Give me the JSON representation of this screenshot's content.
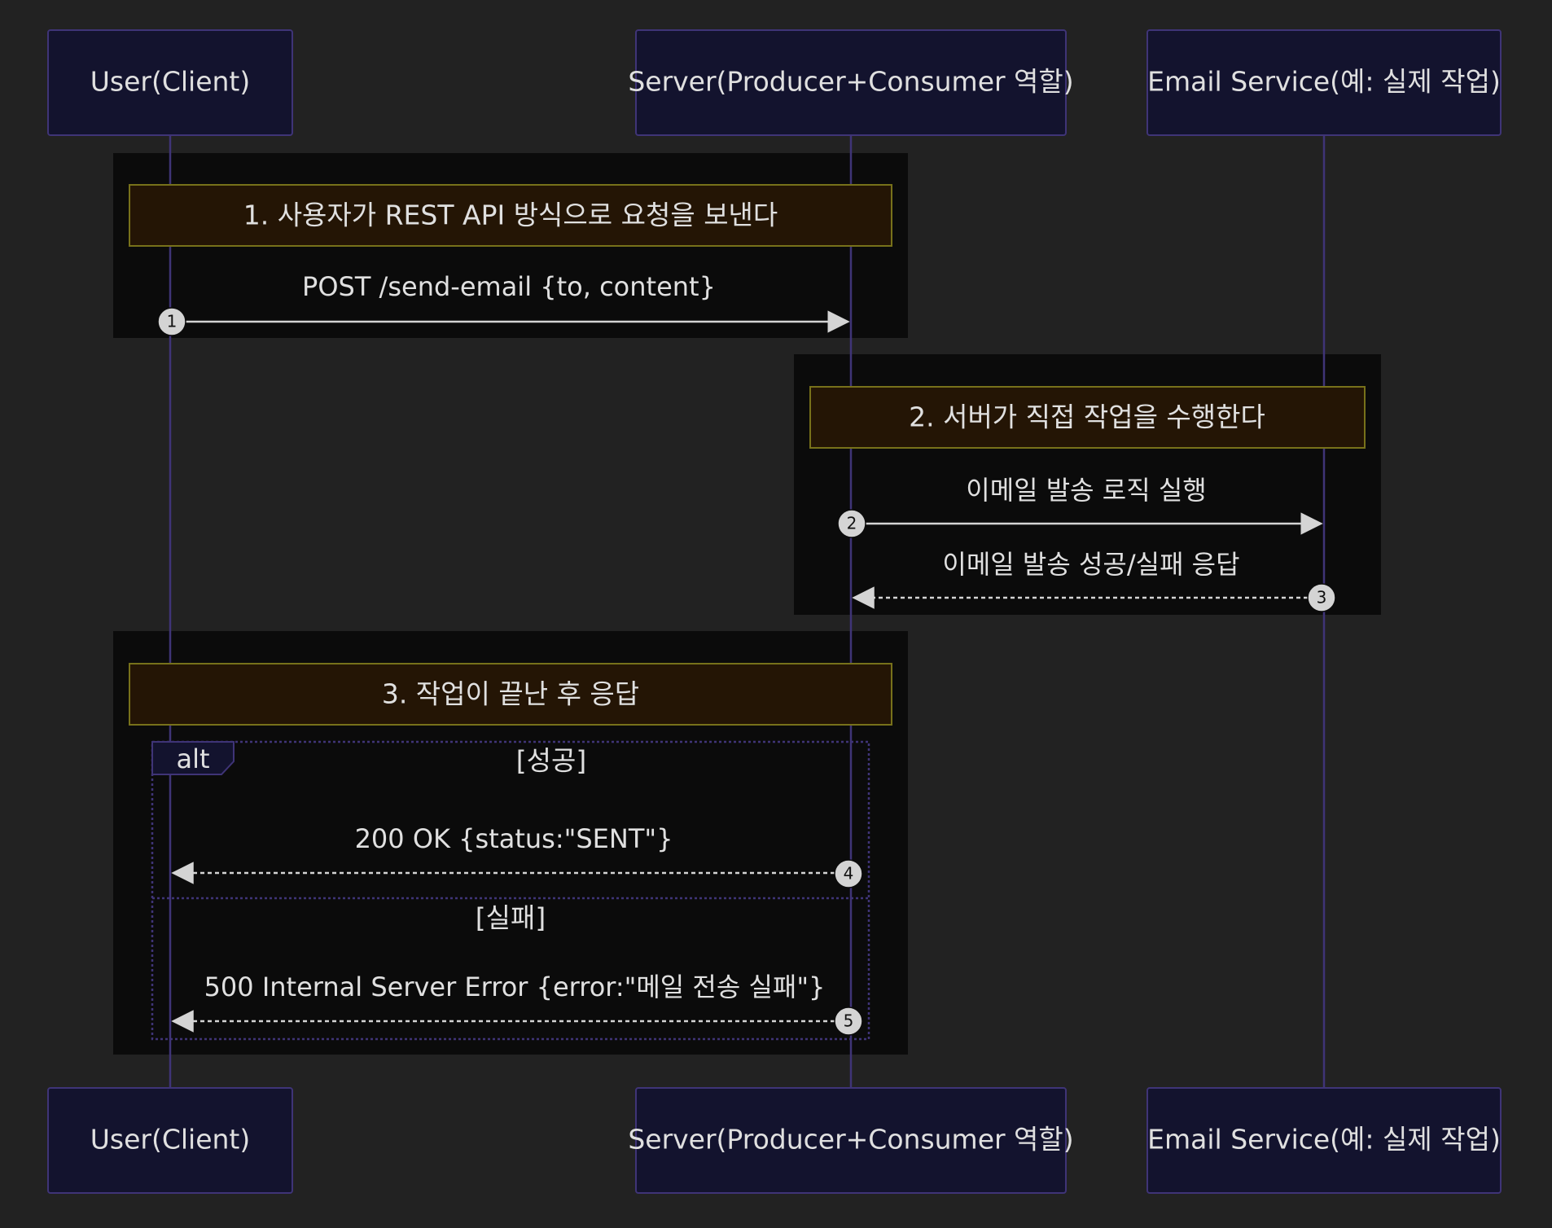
{
  "participants": [
    {
      "id": "user",
      "label": "User(Client)"
    },
    {
      "id": "server",
      "label": "Server(Producer+Consumer 역할)"
    },
    {
      "id": "email",
      "label": "Email Service(예: 실제 작업)"
    }
  ],
  "notes": {
    "step1": "1. 사용자가 REST API 방식으로 요청을 보낸다",
    "step2": "2. 서버가 직접 작업을 수행한다",
    "step3": "3. 작업이 끝난 후 응답"
  },
  "messages": [
    {
      "num": "1",
      "text": "POST /send-email {to, content}",
      "from": "user",
      "to": "server",
      "style": "solid"
    },
    {
      "num": "2",
      "text": "이메일 발송 로직 실행",
      "from": "server",
      "to": "email",
      "style": "solid"
    },
    {
      "num": "3",
      "text": "이메일 발송 성공/실패 응답",
      "from": "email",
      "to": "server",
      "style": "dashed"
    },
    {
      "num": "4",
      "text": "200 OK {status:\"SENT\"}",
      "from": "server",
      "to": "user",
      "style": "dashed"
    },
    {
      "num": "5",
      "text": "500 Internal Server Error {error:\"메일 전송 실패\"}",
      "from": "server",
      "to": "user",
      "style": "dashed"
    }
  ],
  "alt": {
    "label": "alt",
    "success_guard": "[성공]",
    "failure_guard": "[실패]"
  },
  "colors": {
    "background": "#222222",
    "actor_fill": "#13132e",
    "actor_stroke": "#3f3477",
    "lifeline": "#3f3477",
    "rect_fill": "#0b0b0b",
    "note_fill": "#241505",
    "note_stroke": "#77711a",
    "arrow": "#d4d4d4",
    "badge_fill": "#d4d4d4",
    "text": "#e0e0e0"
  }
}
